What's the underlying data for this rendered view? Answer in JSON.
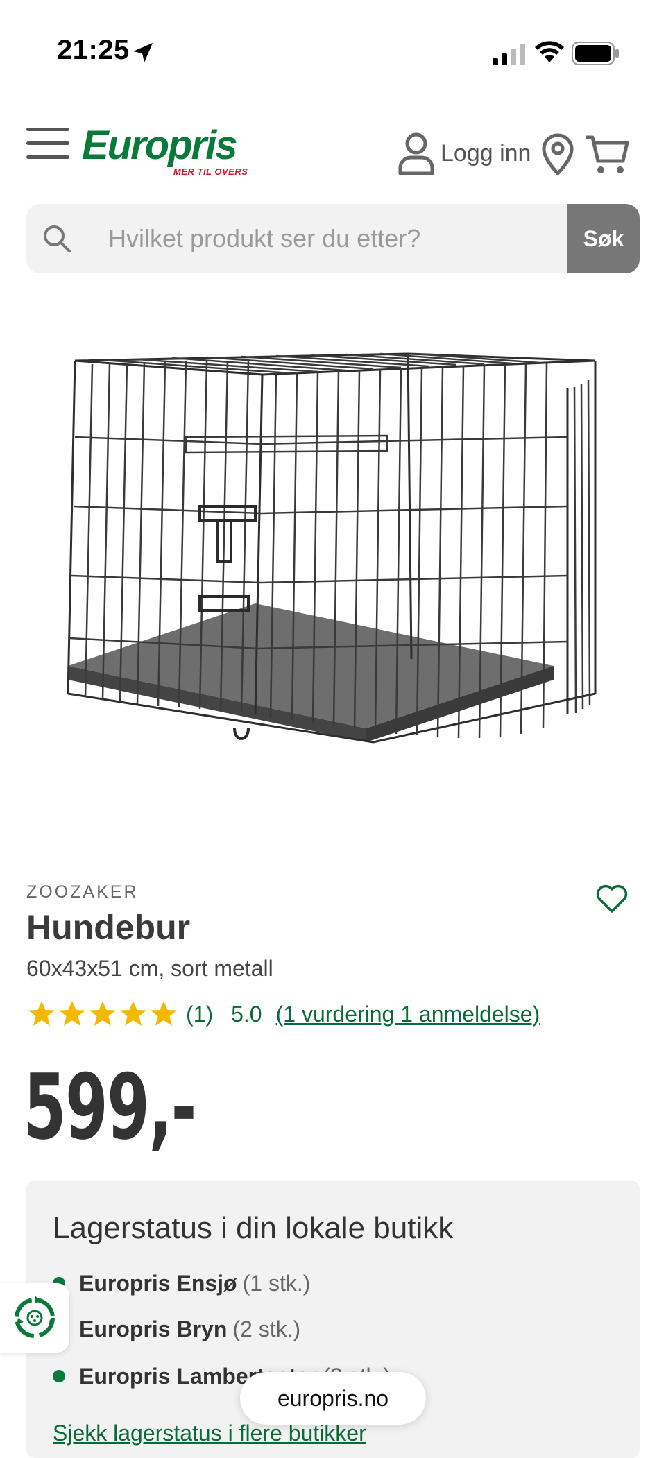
{
  "status_bar": {
    "time": "21:25"
  },
  "header": {
    "logo_text": "Europris",
    "logo_tagline": "MER TIL OVERS",
    "login_label": "Logg inn"
  },
  "search": {
    "placeholder": "Hvilket produkt ser du etter?",
    "button_label": "Søk"
  },
  "product": {
    "brand": "ZOOZAKER",
    "title": "Hundebur",
    "subtitle": "60x43x51 cm, sort metall",
    "rating": {
      "stars": 5,
      "count": "(1)",
      "score": "5.0",
      "link": "(1 vurdering 1 anmeldelse)"
    },
    "price": "599,-"
  },
  "stock": {
    "title": "Lagerstatus i din lokale butikk",
    "stores": [
      {
        "name": "Europris Ensjø",
        "qty": "(1 stk.)"
      },
      {
        "name": "Europris Bryn",
        "qty": "(2 stk.)"
      },
      {
        "name": "Europris Lambertseter",
        "qty": "(2 stk.)"
      }
    ],
    "link": "Sjekk lagerstatus i flere butikker"
  },
  "browser": {
    "url": "europris.no"
  },
  "colors": {
    "brand_green": "#0a7a3b",
    "brand_red": "#d8102a",
    "star": "#f5b800"
  }
}
